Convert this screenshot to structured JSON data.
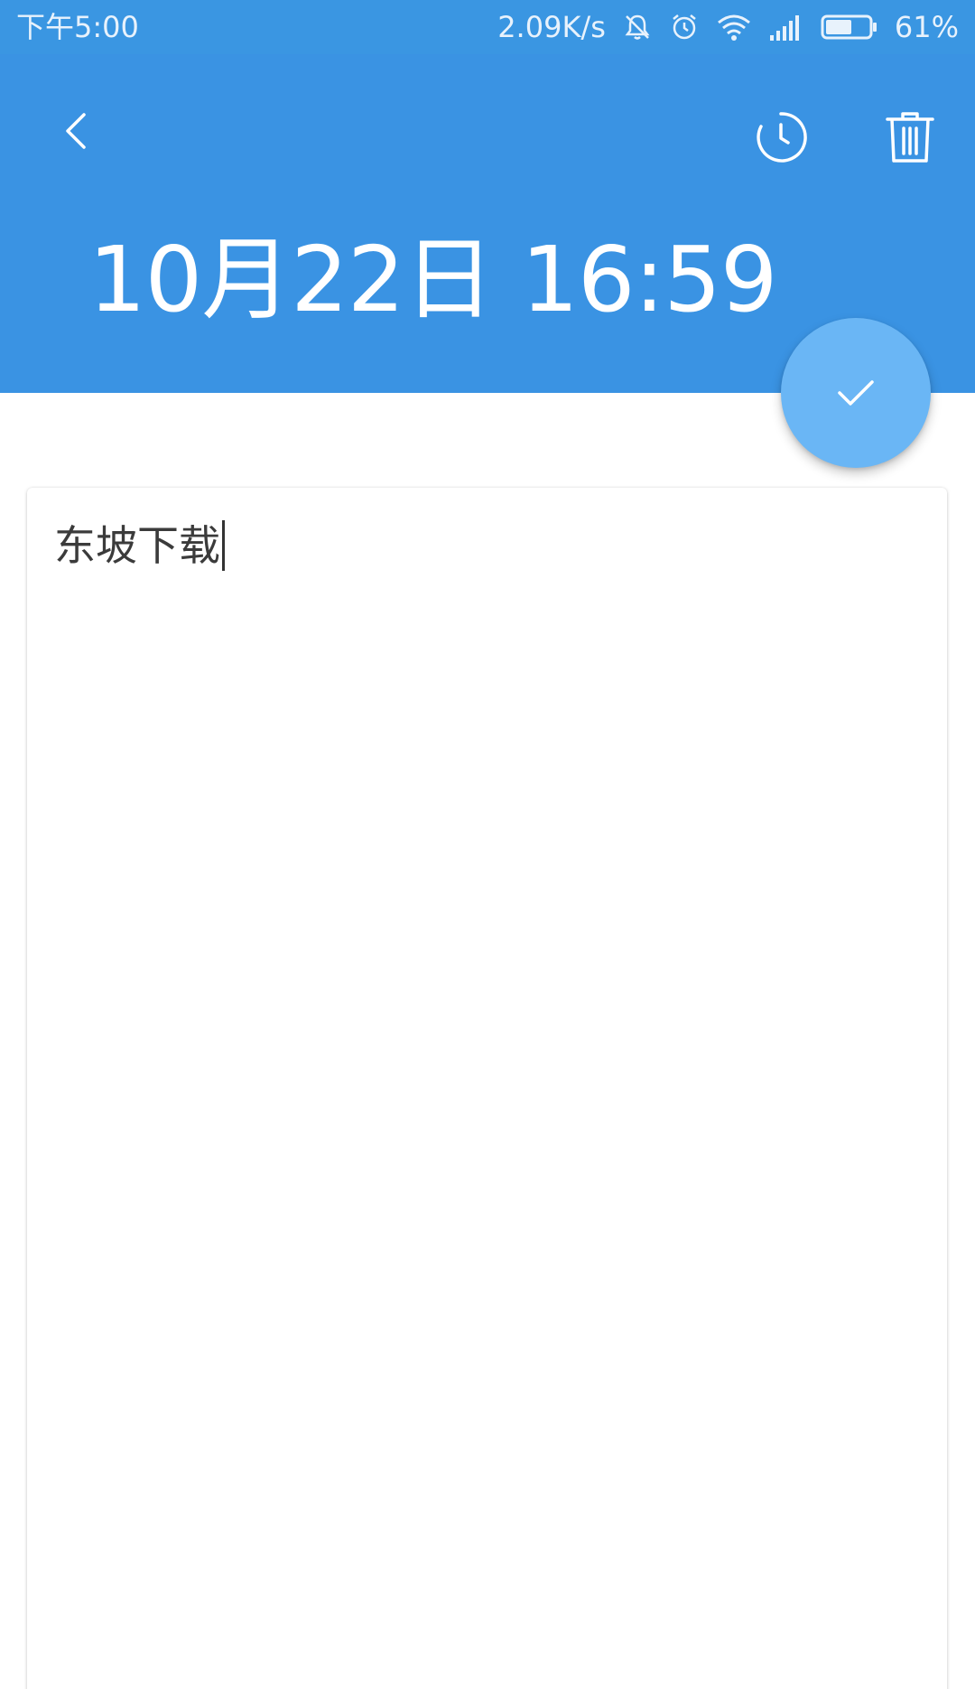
{
  "status_bar": {
    "time": "下午5:00",
    "network_speed": "2.09K/s",
    "battery_percent": "61%",
    "battery_level": 0.61,
    "icons": [
      "mute-icon",
      "alarm-icon",
      "wifi-icon",
      "signal-icon",
      "battery-icon"
    ]
  },
  "header": {
    "title": "10月22日 16:59",
    "icons": [
      "back-icon",
      "history-icon",
      "trash-icon"
    ]
  },
  "fab": {
    "icon": "check-icon"
  },
  "note": {
    "content": "东坡下载"
  },
  "colors": {
    "header_bg": "#3a93e3",
    "status_bg": "#3a96e2",
    "fab_bg": "#6ab6f5",
    "text": "#3b3b3b"
  }
}
